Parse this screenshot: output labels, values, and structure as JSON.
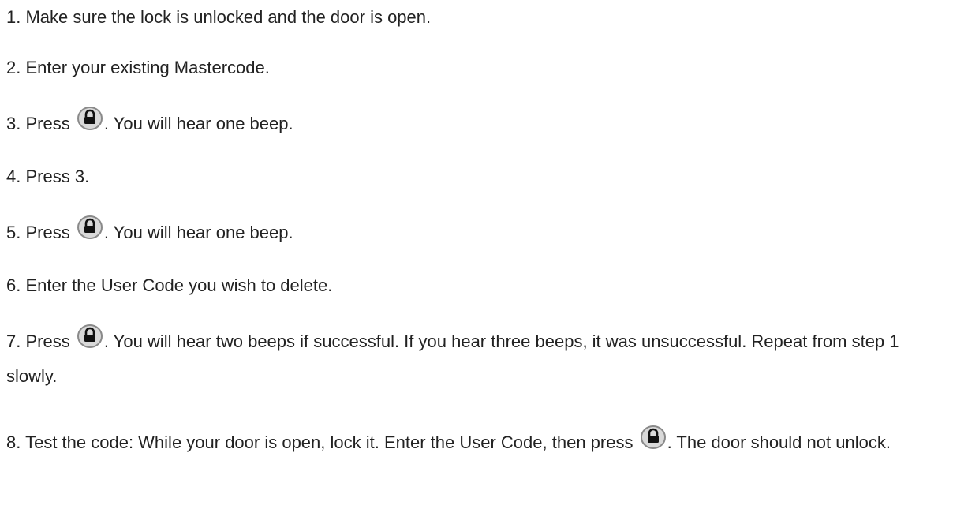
{
  "steps": [
    {
      "number": "1.",
      "text": "Make sure the lock is unlocked and the door is open."
    },
    {
      "number": "2.",
      "text": "Enter your existing Mastercode."
    },
    {
      "number": "3.",
      "before": "Press",
      "after": ". You will hear one beep.",
      "icon": "lock-button-icon"
    },
    {
      "number": "4.",
      "text": "Press 3."
    },
    {
      "number": "5.",
      "before": "Press",
      "after": ". You will hear one beep.",
      "icon": "lock-button-icon"
    },
    {
      "number": "6.",
      "text": "Enter the User Code you wish to delete."
    },
    {
      "number": "7.",
      "before": "Press",
      "after": ". You will hear two beeps if successful. If you hear three beeps, it was unsuccessful. Repeat from step 1 slowly.",
      "icon": "lock-button-icon"
    },
    {
      "number": "8.",
      "before": "Test the code: While your door is open, lock it. Enter the User Code, then press",
      "after": ". The door should not unlock.",
      "icon": "lock-button-icon"
    }
  ],
  "colors": {
    "text": "#222222",
    "icon_fill": "#d9d9d9",
    "icon_stroke": "#8a8a8a",
    "icon_lock": "#111111"
  }
}
